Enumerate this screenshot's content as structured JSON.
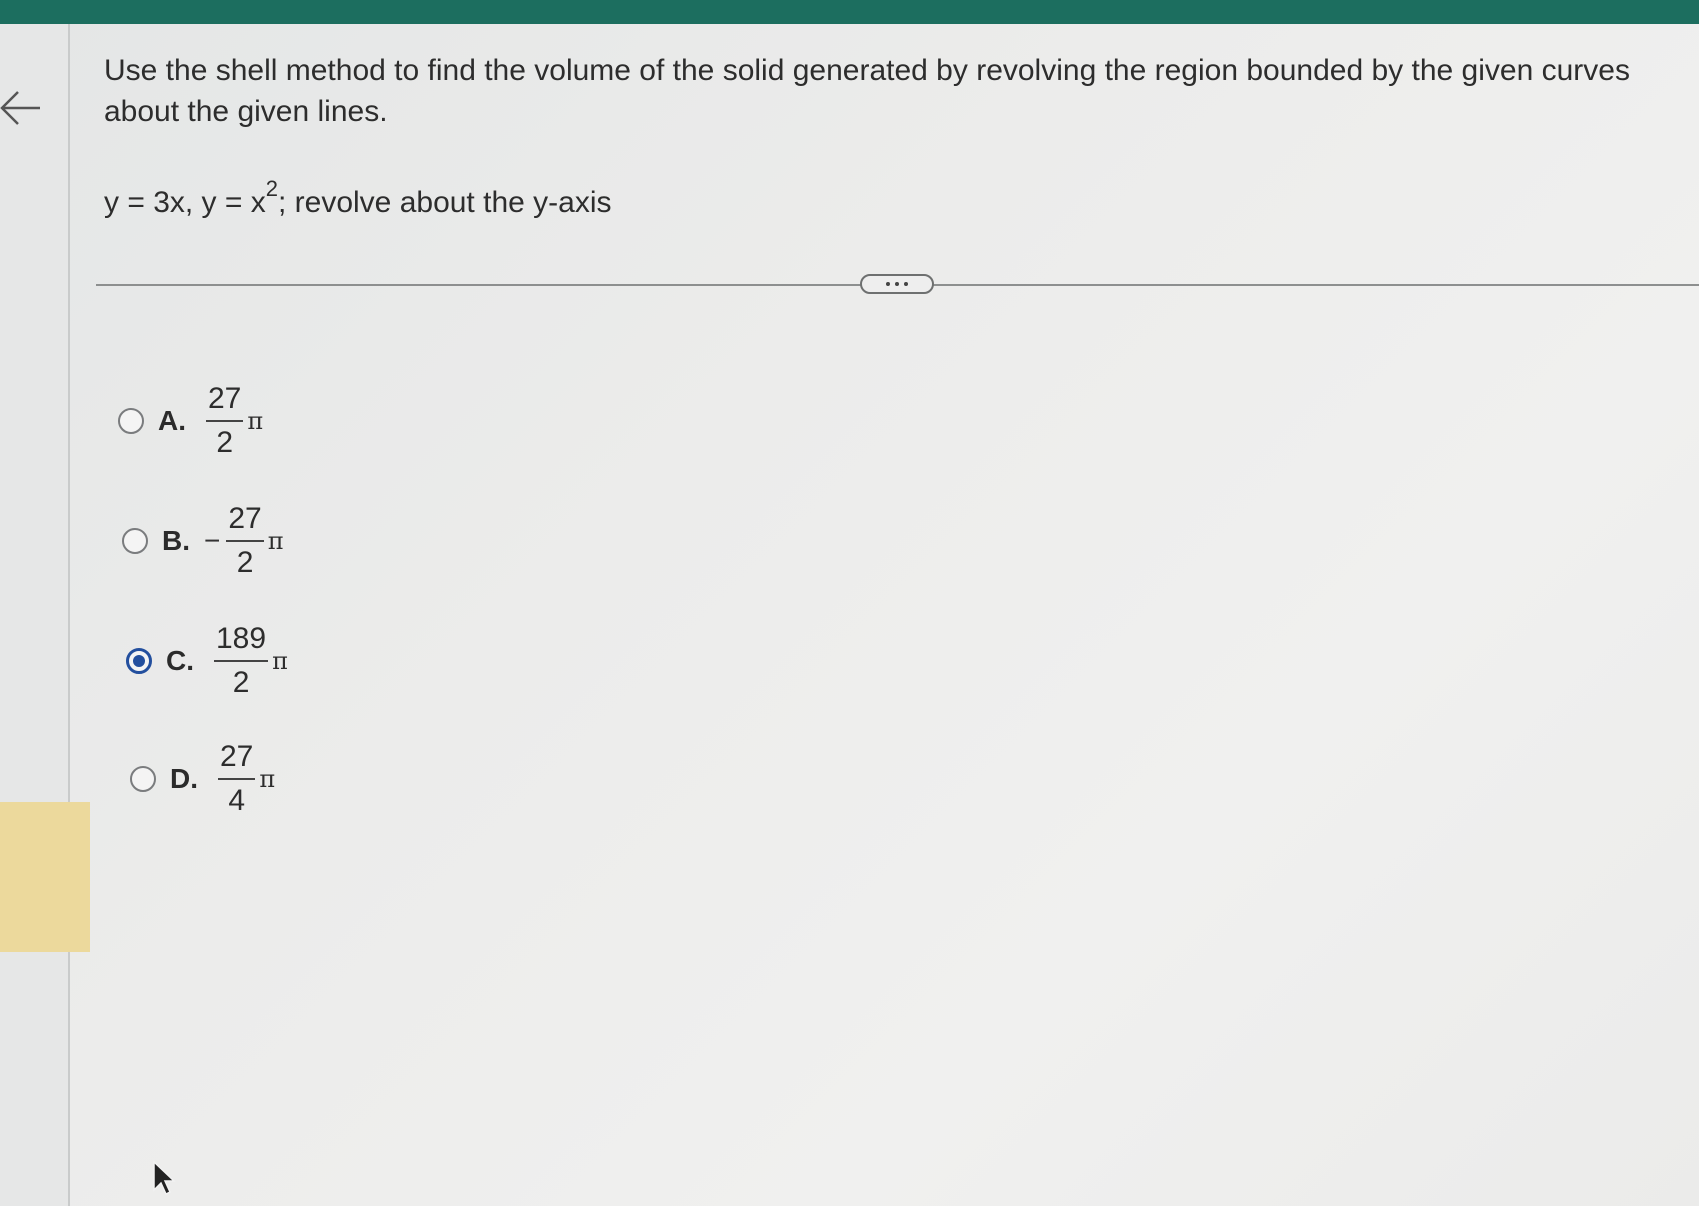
{
  "question": {
    "text": "Use the shell method to find the volume of the solid generated by revolving the region bounded by the given curves about the given lines.",
    "equation_part1": "y = 3x, y = x",
    "equation_exponent": "2",
    "equation_part2": "; revolve about the y-axis"
  },
  "icons": {
    "back": "back-arrow-icon",
    "more": "more-ellipsis-icon",
    "cursor": "mouse-pointer-icon"
  },
  "options": [
    {
      "letter": "A.",
      "sign": "",
      "numerator": "27",
      "denominator": "2",
      "constant": "π",
      "selected": false
    },
    {
      "letter": "B.",
      "sign": "−",
      "numerator": "27",
      "denominator": "2",
      "constant": "π",
      "selected": false
    },
    {
      "letter": "C.",
      "sign": "",
      "numerator": "189",
      "denominator": "2",
      "constant": "π",
      "selected": true
    },
    {
      "letter": "D.",
      "sign": "",
      "numerator": "27",
      "denominator": "4",
      "constant": "π",
      "selected": false
    }
  ],
  "colors": {
    "top_bar": "#1c6e5f",
    "selected_radio": "#234f9e",
    "rail_highlight": "#ecd99c"
  }
}
